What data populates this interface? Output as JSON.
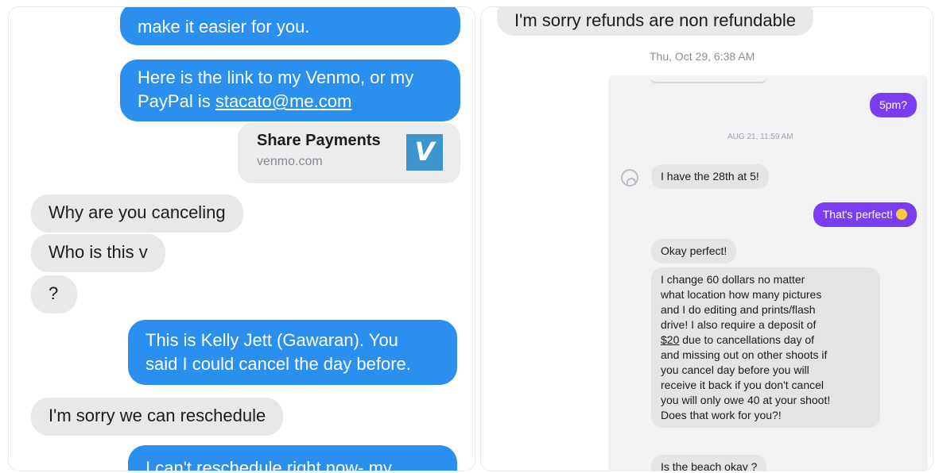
{
  "left_thread": {
    "msg1_top_cut": "make it easier for you.",
    "msg2_line1": "Here is the link to my Venmo, or my",
    "msg2_line2_prefix": "PayPal is ",
    "msg2_email": "stacato@me.com",
    "link_card": {
      "title": "Share Payments",
      "domain": "venmo.com",
      "logo_letter": "V",
      "logo_color": "#3d95ce"
    },
    "reply1": "Why are you canceling",
    "reply2": "Who is this v",
    "reply3": "?",
    "msg3_line1": "This is Kelly Jett (Gawaran). You",
    "msg3_line2": "said I could cancel the day before.",
    "reply4": "I'm sorry we can reschedule",
    "msg4_cut": "I can't reschedule right now- my"
  },
  "right_thread": {
    "top_cut": "I'm sorry refunds are non refundable",
    "timestamp": "Thu, Oct 29, 6:38 AM",
    "inner": {
      "bubble_5pm": "5pm?",
      "timestamp": "AUG 21, 11:59 AM",
      "msg_28th": "I have the 28th at 5!",
      "msg_perfect": "That's perfect!",
      "msg_okay": "Okay perfect!",
      "long_message": [
        "I change 60 dollars  no matter",
        "what location how many pictures",
        "and I do editing and prints/flash",
        "drive!  I also require a deposit of",
        "$20 due to cancellations day of",
        "and missing out on other shoots if",
        "you cancel day before you will",
        "receive it back if you don't cancel",
        "you will only owe 40 at your shoot!",
        "Does that work for you?!"
      ],
      "msg_beach": "Is the beach okay ?"
    }
  },
  "colors": {
    "imessage_blue": "#2b8ff0",
    "received_gray": "#e8e8eb",
    "purple_sent": "#7b3df2"
  }
}
